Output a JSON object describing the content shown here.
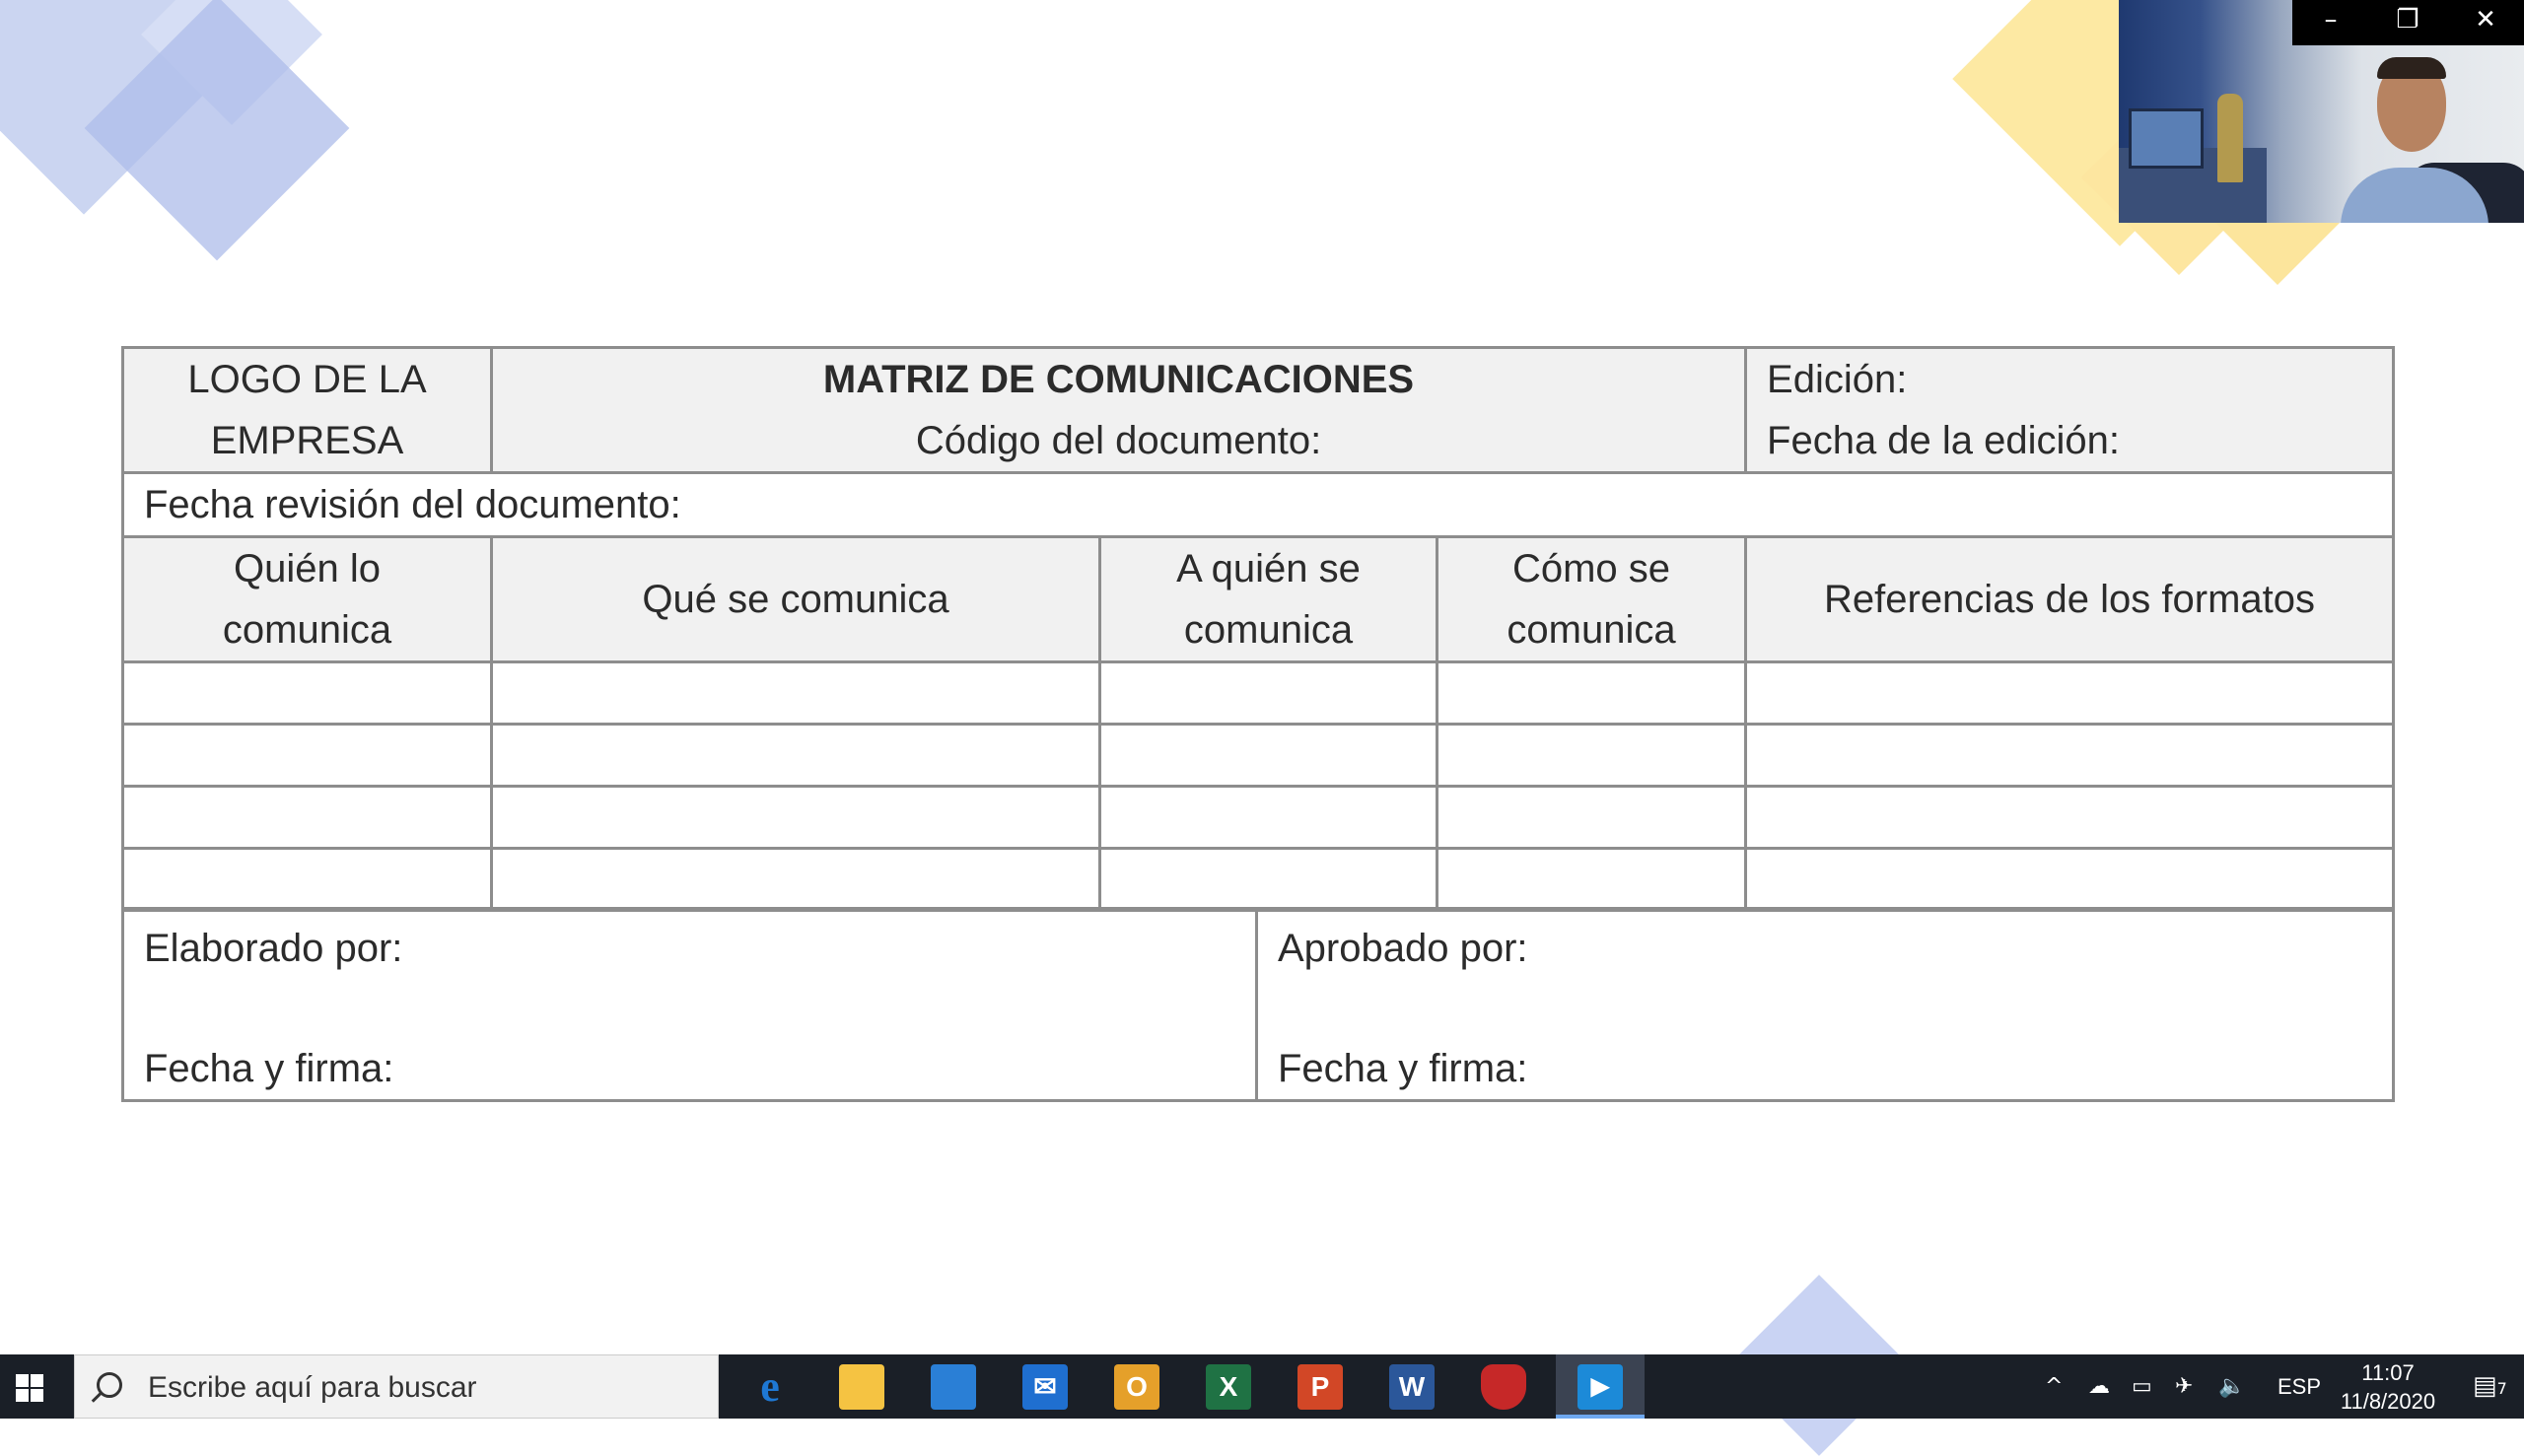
{
  "document": {
    "logo_line1": "LOGO DE LA",
    "logo_line2": "EMPRESA",
    "title": "MATRIZ DE COMUNICACIONES",
    "doc_code": "Código del documento:",
    "edition": "Edición:",
    "edition_date": "Fecha de la edición:",
    "revision_date": "Fecha revisión del documento:",
    "columns": [
      {
        "line1": "Quién lo",
        "line2": "comunica"
      },
      {
        "line1": "Qué se comunica",
        "line2": ""
      },
      {
        "line1": "A quién se",
        "line2": "comunica"
      },
      {
        "line1": "Cómo se",
        "line2": "comunica"
      },
      {
        "line1": "Referencias de los formatos",
        "line2": ""
      }
    ],
    "elaborated_by": "Elaborado por:",
    "approved_by": "Aprobado por:",
    "date_signature": "Fecha y firma:"
  },
  "video_window": {
    "minimize": "–",
    "restore": "❐",
    "close": "✕"
  },
  "taskbar": {
    "search_placeholder": "Escribe aquí para buscar",
    "apps": [
      {
        "name": "edge",
        "glyph": "e",
        "color": "#1e78d4"
      },
      {
        "name": "file-explorer",
        "glyph": "",
        "color": "#f5c342"
      },
      {
        "name": "store",
        "glyph": "",
        "color": "#2a7fd6"
      },
      {
        "name": "mail",
        "glyph": "✉",
        "color": "#1f6fd0"
      },
      {
        "name": "outlook",
        "glyph": "O",
        "color": "#e5a02a"
      },
      {
        "name": "excel",
        "glyph": "X",
        "color": "#1f7244"
      },
      {
        "name": "powerpoint",
        "glyph": "P",
        "color": "#d24726"
      },
      {
        "name": "word",
        "glyph": "W",
        "color": "#2b579a"
      },
      {
        "name": "security",
        "glyph": "",
        "color": "#c62828"
      },
      {
        "name": "media-player",
        "glyph": "▶",
        "color": "#1c8ad8"
      }
    ],
    "language": "ESP",
    "time": "11:07",
    "date": "11/8/2020",
    "notifications_count": "7"
  }
}
